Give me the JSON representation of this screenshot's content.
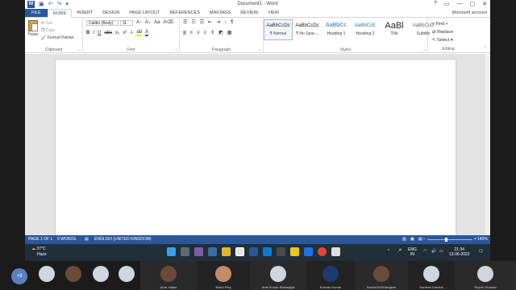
{
  "window": {
    "title": "Document1 - Word",
    "app_icon": "W",
    "controls": [
      "?",
      "▭",
      "—",
      "▢",
      "✕"
    ]
  },
  "tabs": {
    "file": "FILE",
    "items": [
      "HOME",
      "INSERT",
      "DESIGN",
      "PAGE LAYOUT",
      "REFERENCES",
      "MAILINGS",
      "REVIEW",
      "VIEW"
    ],
    "active": "HOME",
    "account": "Microsoft account"
  },
  "ribbon": {
    "clipboard": {
      "label": "Clipboard",
      "paste": "Paste",
      "cut": "Cut",
      "copy": "Copy",
      "format_painter": "Format Painter"
    },
    "font": {
      "label": "Font",
      "name": "Calibri (Body)",
      "size": "11"
    },
    "paragraph": {
      "label": "Paragraph"
    },
    "styles": {
      "label": "Styles",
      "items": [
        {
          "sample": "AaBbCcDc",
          "name": "¶ Normal"
        },
        {
          "sample": "AaBbCcDc",
          "name": "¶ No Spac..."
        },
        {
          "sample": "AaBbCc",
          "name": "Heading 1"
        },
        {
          "sample": "AaBbCcE",
          "name": "Heading 2"
        },
        {
          "sample": "AaBl",
          "name": "Title"
        },
        {
          "sample": "AaBbCcD",
          "name": "Subtitle"
        }
      ]
    },
    "editing": {
      "label": "Editing",
      "find": "Find",
      "replace": "Replace",
      "select": "Select"
    }
  },
  "statusbar": {
    "page": "PAGE 1 OF 1",
    "words": "0 WORDS",
    "language": "ENGLISH (UNITED KINGDOM)",
    "zoom": "140%",
    "zoom_level": 0.4
  },
  "taskbar": {
    "weather_temp": "37°C",
    "weather_desc": "Haze",
    "lang1": "ENG",
    "lang2": "IN",
    "time": "21:34",
    "date": "13-06-2022"
  },
  "meeting": {
    "more_count": "+9",
    "participants": [
      "Arun Yadav",
      "Mohd Firoj",
      "Amit Kumar Ramsujiya",
      "Krishan Kumar",
      "Sachin%20Gangwar",
      "Somesh Kandoli",
      "Piyush Sharma"
    ]
  },
  "colors": {
    "accent": "#2b579a",
    "taskbar": "#202f3a"
  }
}
